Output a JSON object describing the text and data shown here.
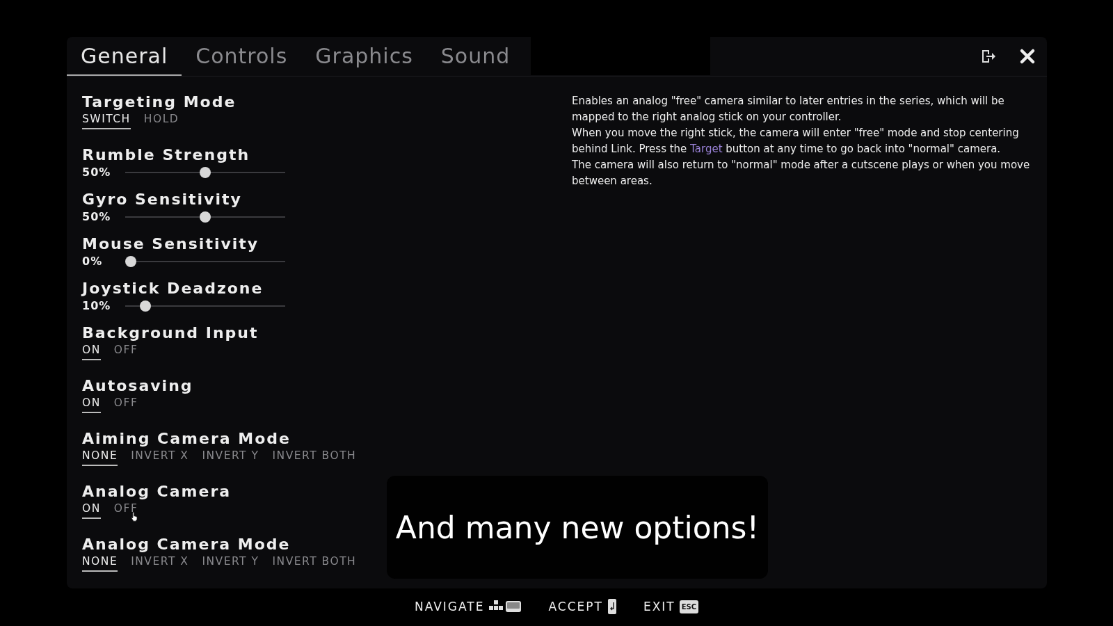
{
  "tabs": [
    {
      "label": "General",
      "selected": true
    },
    {
      "label": "Controls",
      "selected": false
    },
    {
      "label": "Graphics",
      "selected": false
    },
    {
      "label": "Sound",
      "selected": false
    }
  ],
  "settings": [
    {
      "kind": "choice",
      "title": "Targeting Mode",
      "options": [
        {
          "label": "SWITCH",
          "selected": true
        },
        {
          "label": "HOLD",
          "selected": false
        }
      ]
    },
    {
      "kind": "slider",
      "title": "Rumble Strength",
      "reading": "50%",
      "level": 0.5
    },
    {
      "kind": "slider",
      "title": "Gyro Sensitivity",
      "reading": "50%",
      "level": 0.5
    },
    {
      "kind": "slider",
      "title": "Mouse Sensitivity",
      "reading": "0%",
      "level": 0
    },
    {
      "kind": "slider",
      "title": "Joystick Deadzone",
      "reading": "10%",
      "level": 0.1
    },
    {
      "kind": "choice",
      "title": "Background Input",
      "options": [
        {
          "label": "ON",
          "selected": true
        },
        {
          "label": "OFF",
          "selected": false
        }
      ]
    },
    {
      "kind": "choice",
      "title": "Autosaving",
      "options": [
        {
          "label": "ON",
          "selected": true
        },
        {
          "label": "OFF",
          "selected": false
        }
      ]
    },
    {
      "kind": "choice",
      "title": "Aiming Camera Mode",
      "options": [
        {
          "label": "NONE",
          "selected": true
        },
        {
          "label": "INVERT X",
          "selected": false
        },
        {
          "label": "INVERT Y",
          "selected": false
        },
        {
          "label": "INVERT BOTH",
          "selected": false
        }
      ]
    },
    {
      "kind": "choice",
      "title": "Analog Camera",
      "options": [
        {
          "label": "ON",
          "selected": true
        },
        {
          "label": "OFF",
          "selected": false,
          "hovered": true
        }
      ]
    },
    {
      "kind": "choice",
      "title": "Analog Camera Mode",
      "options": [
        {
          "label": "NONE",
          "selected": true
        },
        {
          "label": "INVERT X",
          "selected": false
        },
        {
          "label": "INVERT Y",
          "selected": false
        },
        {
          "label": "INVERT BOTH",
          "selected": false
        }
      ]
    }
  ],
  "description": [
    "Enables an analog \"free\" camera similar to later entries in the series, which will be mapped to the right analog stick on your controller.",
    "When you move the right stick, the camera will enter \"free\" mode and stop centering behind Link. Press the **Target** button at any time to go back into \"normal\" camera.",
    "The camera will also return to \"normal\" mode after a cutscene plays or when you move between areas."
  ],
  "caption": "And many new options!",
  "footer": [
    {
      "label": "NAVIGATE"
    },
    {
      "label": "ACCEPT"
    },
    {
      "label": "EXIT",
      "key_text": "ESC"
    }
  ]
}
